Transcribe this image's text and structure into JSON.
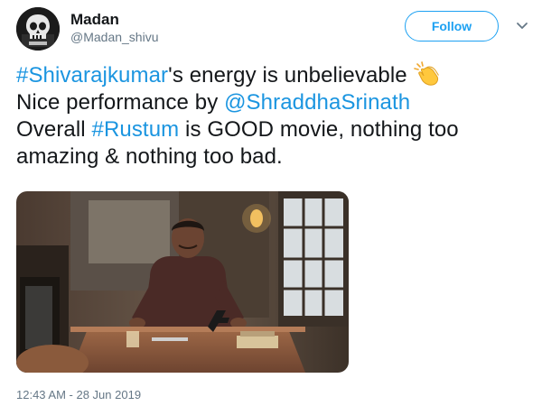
{
  "user": {
    "display_name": "Madan",
    "handle": "@Madan_shivu",
    "avatar_icon": "skull-avatar"
  },
  "follow": {
    "label": "Follow"
  },
  "menu": {
    "icon": "chevron-down-icon"
  },
  "tweet": {
    "line1": {
      "hashtag": "#Shivarajkumar",
      "text": "'s energy is unbelievable",
      "emoji": "clapping-hands-icon"
    },
    "line2": {
      "text": "Nice performance by ",
      "mention": "@ShraddhaSrinath"
    },
    "line3": {
      "prefix": "Overall ",
      "hashtag": "#Rustum",
      "suffix": " is GOOD movie, nothing too"
    },
    "line4": {
      "text": "amazing & nothing too bad."
    }
  },
  "media": {
    "description_icon": "photo"
  },
  "timestamp": "12:43 AM - 28 Jun 2019",
  "colors": {
    "link": "#1b95e0",
    "follow_border": "#1da1f2",
    "secondary_text": "#657786",
    "primary_text": "#14171a"
  }
}
